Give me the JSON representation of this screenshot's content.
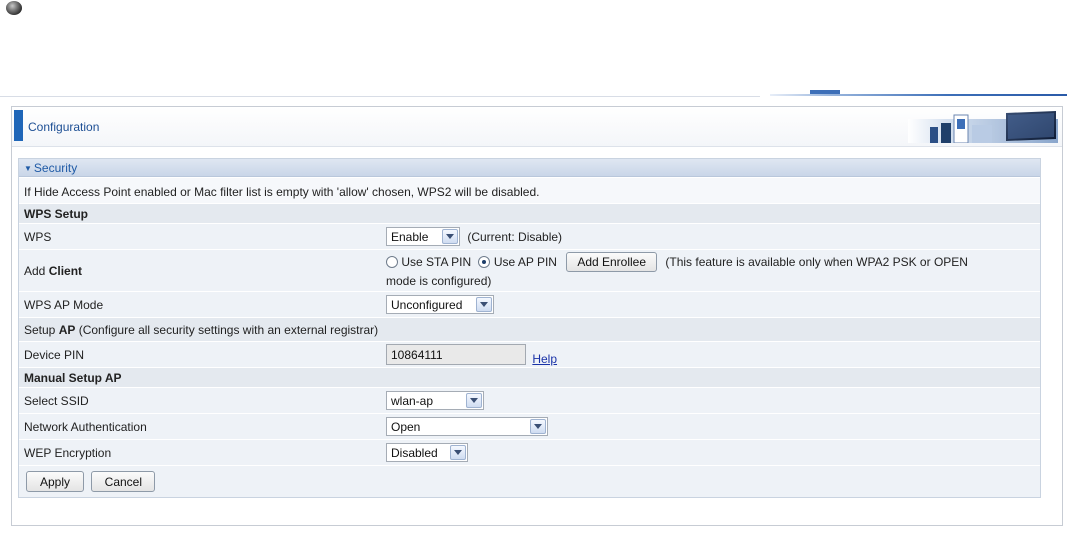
{
  "header": {
    "title": "Configuration"
  },
  "panel": {
    "title": "Security"
  },
  "notice": "If Hide Access Point enabled or Mac filter list is empty with 'allow' chosen, WPS2 will be disabled.",
  "wps_setup": {
    "section_label": "WPS Setup",
    "wps": {
      "label": "WPS",
      "selected": "Enable",
      "current": "(Current: Disable)"
    },
    "add_client": {
      "label_plain": "Add",
      "label_bold": "Client",
      "option_sta": "Use STA PIN",
      "option_ap": "Use AP PIN",
      "selected_option": "Use AP PIN",
      "enrollee_button": "Add Enrollee",
      "note_line1": "(This feature is available only when WPA2 PSK or OPEN",
      "note_line2": "mode is configured)"
    },
    "ap_mode": {
      "label": "WPS AP Mode",
      "selected": "Unconfigured"
    }
  },
  "setup_ap": {
    "label_plain": "Setup",
    "label_bold": "AP",
    "label_note": "(Configure all security settings with an external registrar)",
    "device_pin": {
      "label": "Device PIN",
      "value": "10864111",
      "help": "Help"
    }
  },
  "manual_setup": {
    "section_label": "Manual Setup AP",
    "ssid": {
      "label": "Select SSID",
      "selected": "wlan-ap"
    },
    "auth": {
      "label": "Network Authentication",
      "selected": "Open"
    },
    "wep": {
      "label": "WEP Encryption",
      "selected": "Disabled"
    }
  },
  "actions": {
    "apply": "Apply",
    "cancel": "Cancel"
  },
  "colors": {
    "accent": "#1f66b8",
    "link": "#1a33a8",
    "row_bg": "#eef2f7",
    "section_bg": "#e4e9ef"
  }
}
